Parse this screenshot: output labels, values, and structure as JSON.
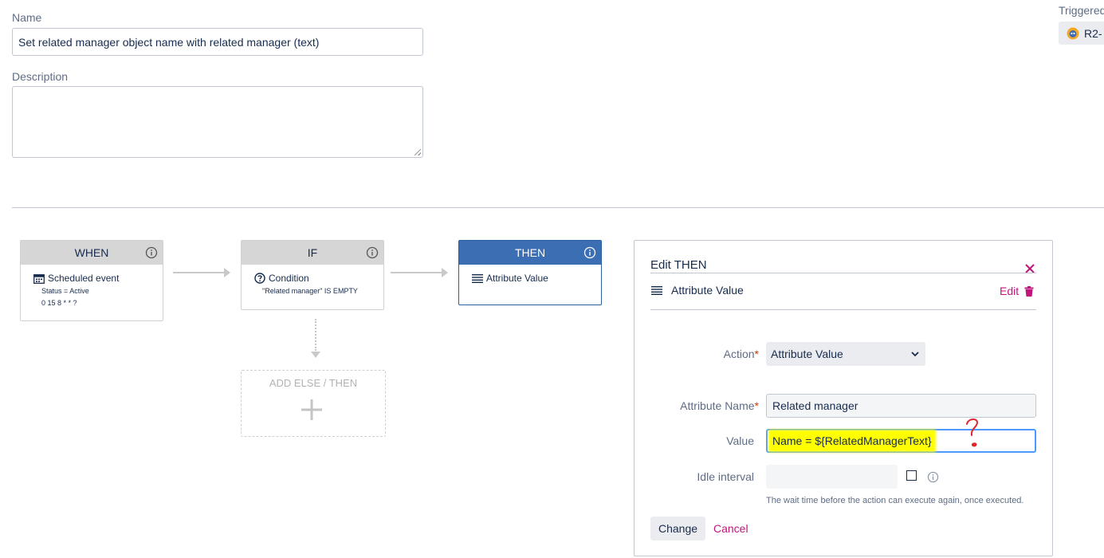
{
  "form": {
    "name_label": "Name",
    "name_value": "Set related manager object name with related manager (text)",
    "description_label": "Description",
    "description_value": ""
  },
  "triggered": {
    "label": "Triggered",
    "chip_text": "R2-"
  },
  "rule": {
    "when": {
      "header": "WHEN",
      "title": "Scheduled event",
      "lines": [
        "Status = Active",
        "0 15 8 * * ?"
      ],
      "icon": "calendar-icon"
    },
    "if": {
      "header": "IF",
      "title": "Condition",
      "lines": [
        "\"Related manager\" IS EMPTY"
      ],
      "icon": "question-circle-icon"
    },
    "then": {
      "header": "THEN",
      "title": "Attribute Value",
      "icon": "list-icon"
    },
    "add_else": {
      "label": "ADD ELSE / THEN",
      "icon": "plus-icon"
    }
  },
  "edit_panel": {
    "title": "Edit THEN",
    "action_name": "Attribute Value",
    "edit_label": "Edit",
    "fields": {
      "action_label": "Action",
      "action_value": "Attribute Value",
      "attribute_name_label": "Attribute Name",
      "attribute_name_value": "Related manager",
      "value_label": "Value",
      "value_value": "Name = ${RelatedManagerText}",
      "idle_label": "Idle interval",
      "idle_value": "",
      "idle_help": "The wait time before the action can execute again, once executed."
    },
    "change_button": "Change",
    "cancel_link": "Cancel"
  },
  "colors": {
    "then_header": "#3c6eb4",
    "accent_pink": "#c0157a",
    "required_red": "#de350b",
    "highlight_yellow": "#ffff00",
    "annotation_red": "#e0262e"
  }
}
